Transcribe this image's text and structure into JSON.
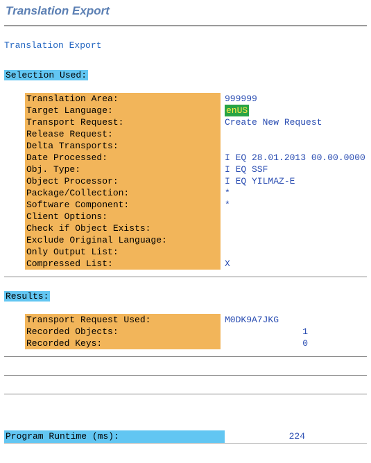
{
  "title": "Translation Export",
  "subhead": "Translation Export",
  "sections": {
    "selection": {
      "heading": "Selection Used:",
      "translation_area": {
        "label": "Translation Area:",
        "value": "999999"
      },
      "target_language": {
        "label": "Target Language:",
        "value": "enUS"
      },
      "transport_request": {
        "label": "Transport Request:",
        "value": "Create New Request"
      },
      "release_request": {
        "label": "Release Request:",
        "value": ""
      },
      "delta_transports": {
        "label": "Delta Transports:",
        "value": ""
      },
      "date_processed": {
        "label": "Date Processed:",
        "value": "I EQ 28.01.2013 00.00.0000"
      },
      "obj_type": {
        "label": "Obj. Type:",
        "value": "I EQ SSF"
      },
      "object_processor": {
        "label": "Object Processor:",
        "value": "I EQ YILMAZ-E"
      },
      "package_collection": {
        "label": "Package/Collection:",
        "value": "*"
      },
      "software_component": {
        "label": "Software Component:",
        "value": "*"
      },
      "client_options": {
        "label": "Client Options:",
        "value": ""
      },
      "check_if_object_exists": {
        "label": "Check if Object Exists:",
        "value": ""
      },
      "exclude_original_language": {
        "label": "Exclude Original Language:",
        "value": ""
      },
      "only_output_list": {
        "label": "Only Output List:",
        "value": ""
      },
      "compressed_list": {
        "label": "Compressed List:",
        "value": "X"
      }
    },
    "results": {
      "heading": "Results:",
      "transport_request_used": {
        "label": "Transport Request Used:",
        "value": "M0DK9A7JKG"
      },
      "recorded_objects": {
        "label": "Recorded Objects:",
        "value": "1"
      },
      "recorded_keys": {
        "label": "Recorded Keys:",
        "value": "0"
      }
    }
  },
  "footer": {
    "runtime_label": "Program Runtime (ms):",
    "runtime_value": "224"
  }
}
